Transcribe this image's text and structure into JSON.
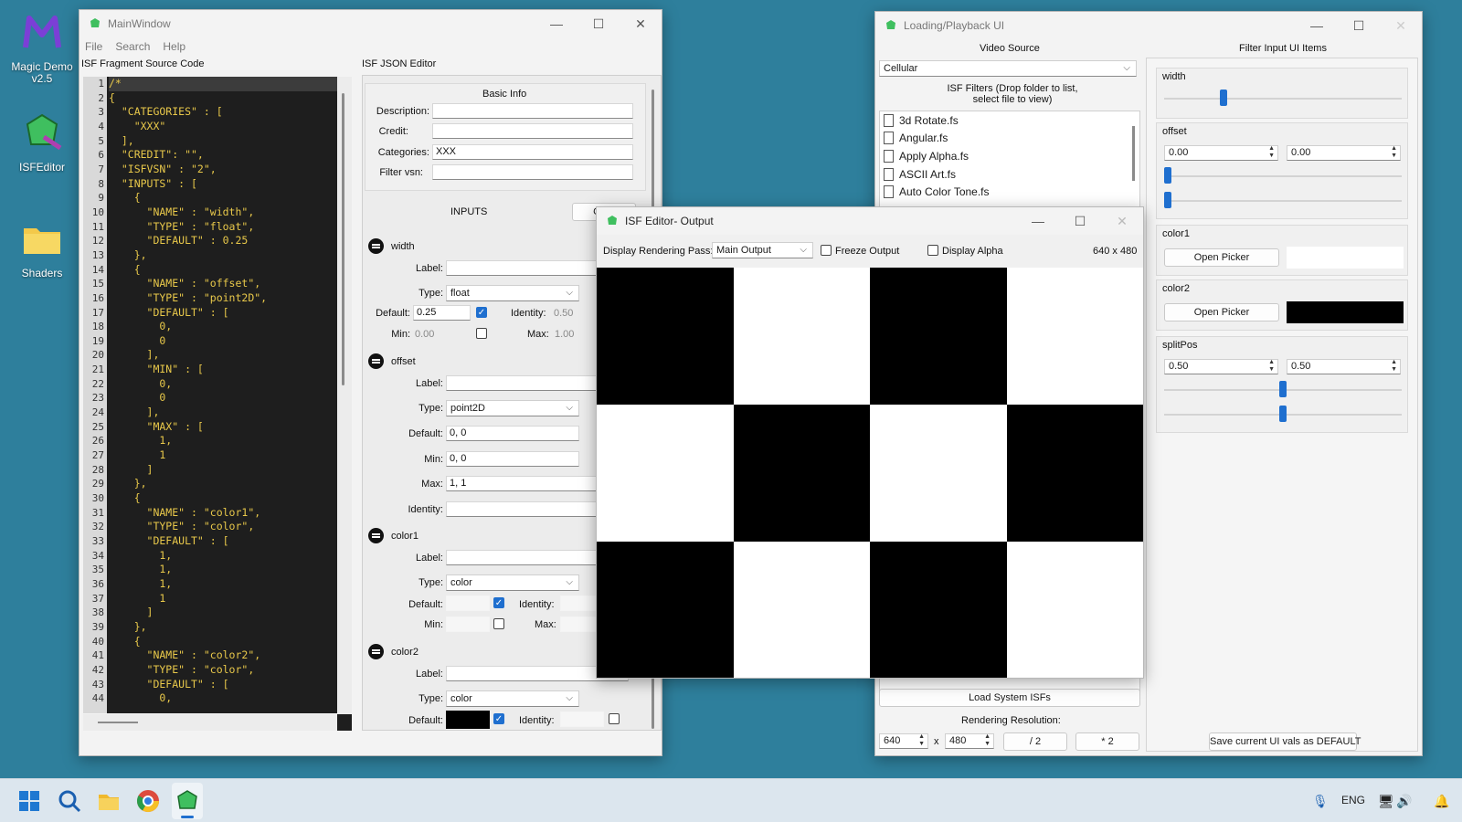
{
  "desktop": {
    "icons": [
      {
        "label": "Magic Demo v2.5"
      },
      {
        "label": "ISFEditor"
      },
      {
        "label": "Shaders"
      }
    ]
  },
  "main_window": {
    "title": "MainWindow",
    "menu": [
      "File",
      "Search",
      "Help"
    ],
    "source_label": "ISF Fragment Source Code",
    "json_label": "ISF JSON Editor",
    "code_lines": [
      "/*",
      "{",
      "  \"CATEGORIES\" : [",
      "    \"XXX\"",
      "  ],",
      "  \"CREDIT\": \"\",",
      "  \"ISFVSN\" : \"2\",",
      "  \"INPUTS\" : [",
      "    {",
      "      \"NAME\" : \"width\",",
      "      \"TYPE\" : \"float\",",
      "      \"DEFAULT\" : 0.25",
      "    },",
      "    {",
      "      \"NAME\" : \"offset\",",
      "      \"TYPE\" : \"point2D\",",
      "      \"DEFAULT\" : [",
      "        0,",
      "        0",
      "      ],",
      "      \"MIN\" : [",
      "        0,",
      "        0",
      "      ],",
      "      \"MAX\" : [",
      "        1,",
      "        1",
      "      ]",
      "    },",
      "    {",
      "      \"NAME\" : \"color1\",",
      "      \"TYPE\" : \"color\",",
      "      \"DEFAULT\" : [",
      "        1,",
      "        1,",
      "        1,",
      "        1",
      "      ]",
      "    },",
      "    {",
      "      \"NAME\" : \"color2\",",
      "      \"TYPE\" : \"color\",",
      "      \"DEFAULT\" : [",
      "        0,"
    ],
    "line_numbers": [
      "1",
      "2",
      "3",
      "4",
      "5",
      "6",
      "7",
      "8",
      "9",
      "10",
      "11",
      "12",
      "13",
      "14",
      "15",
      "16",
      "17",
      "18",
      "19",
      "20",
      "21",
      "22",
      "23",
      "24",
      "25",
      "26",
      "27",
      "28",
      "29",
      "30",
      "31",
      "32",
      "33",
      "34",
      "35",
      "36",
      "37",
      "38",
      "39",
      "40",
      "41",
      "42",
      "43",
      "44"
    ],
    "basic_info": {
      "header": "Basic Info",
      "description_label": "Description:",
      "credit_label": "Credit:",
      "categories_label": "Categories:",
      "categories_value": "XXX",
      "filter_vsn_label": "Filter vsn:"
    },
    "inputs_header": "INPUTS",
    "create_label": "Crea",
    "inputs": {
      "width": {
        "name": "width",
        "label_label": "Label:",
        "type_label": "Type:",
        "type_value": "float",
        "default_label": "Default:",
        "default_value": "0.25",
        "identity_label": "Identity:",
        "identity_value": "0.50",
        "min_label": "Min:",
        "min_value": "0.00",
        "max_label": "Max:",
        "max_value": "1.00"
      },
      "offset": {
        "name": "offset",
        "label_label": "Label:",
        "type_label": "Type:",
        "type_value": "point2D",
        "default_label": "Default:",
        "default_value": "0, 0",
        "min_label": "Min:",
        "min_value": "0, 0",
        "max_label": "Max:",
        "max_value": "1, 1",
        "identity_label": "Identity:"
      },
      "color1": {
        "name": "color1",
        "label_label": "Label:",
        "type_label": "Type:",
        "type_value": "color",
        "default_label": "Default:",
        "identity_label": "Identity:",
        "min_label": "Min:",
        "max_label": "Max:"
      },
      "color2": {
        "name": "color2",
        "label_label": "Label:",
        "type_label": "Type:",
        "type_value": "color",
        "default_label": "Default:",
        "identity_label": "Identity:"
      }
    }
  },
  "output_window": {
    "title": "ISF Editor- Output",
    "pass_label": "Display Rendering Pass:",
    "pass_value": "Main Output",
    "freeze_label": "Freeze Output",
    "alpha_label": "Display Alpha",
    "resolution": "640 x 480",
    "checker_colors": [
      "#000000",
      "#ffffff"
    ]
  },
  "playback_window": {
    "title": "Loading/Playback UI",
    "video_source_label": "Video Source",
    "video_source_value": "Cellular",
    "filters_label": "ISF Filters (Drop folder to list, select file to view)",
    "files": [
      "3d Rotate.fs",
      "Angular.fs",
      "Apply Alpha.fs",
      "ASCII Art.fs",
      "Auto Color Tone.fs"
    ],
    "load_system_label": "Load System ISFs",
    "rendering_res_label": "Rendering Resolution:",
    "res_w": "640",
    "res_x": "x",
    "res_h": "480",
    "half_label": "/ 2",
    "double_label": "* 2",
    "filter_ui_label": "Filter Input UI Items",
    "width_label": "width",
    "width_value": 0.25,
    "offset_label": "offset",
    "offset_x": "0.00",
    "offset_y": "0.00",
    "color1_label": "color1",
    "color2_label": "color2",
    "open_picker": "Open Picker",
    "color1_swatch": "#ffffff",
    "color2_swatch": "#000000",
    "split_label": "splitPos",
    "split_x": "0.50",
    "split_y": "0.50",
    "save_default": "Save current UI vals as DEFAULT"
  },
  "taskbar": {
    "lang": "ENG"
  }
}
